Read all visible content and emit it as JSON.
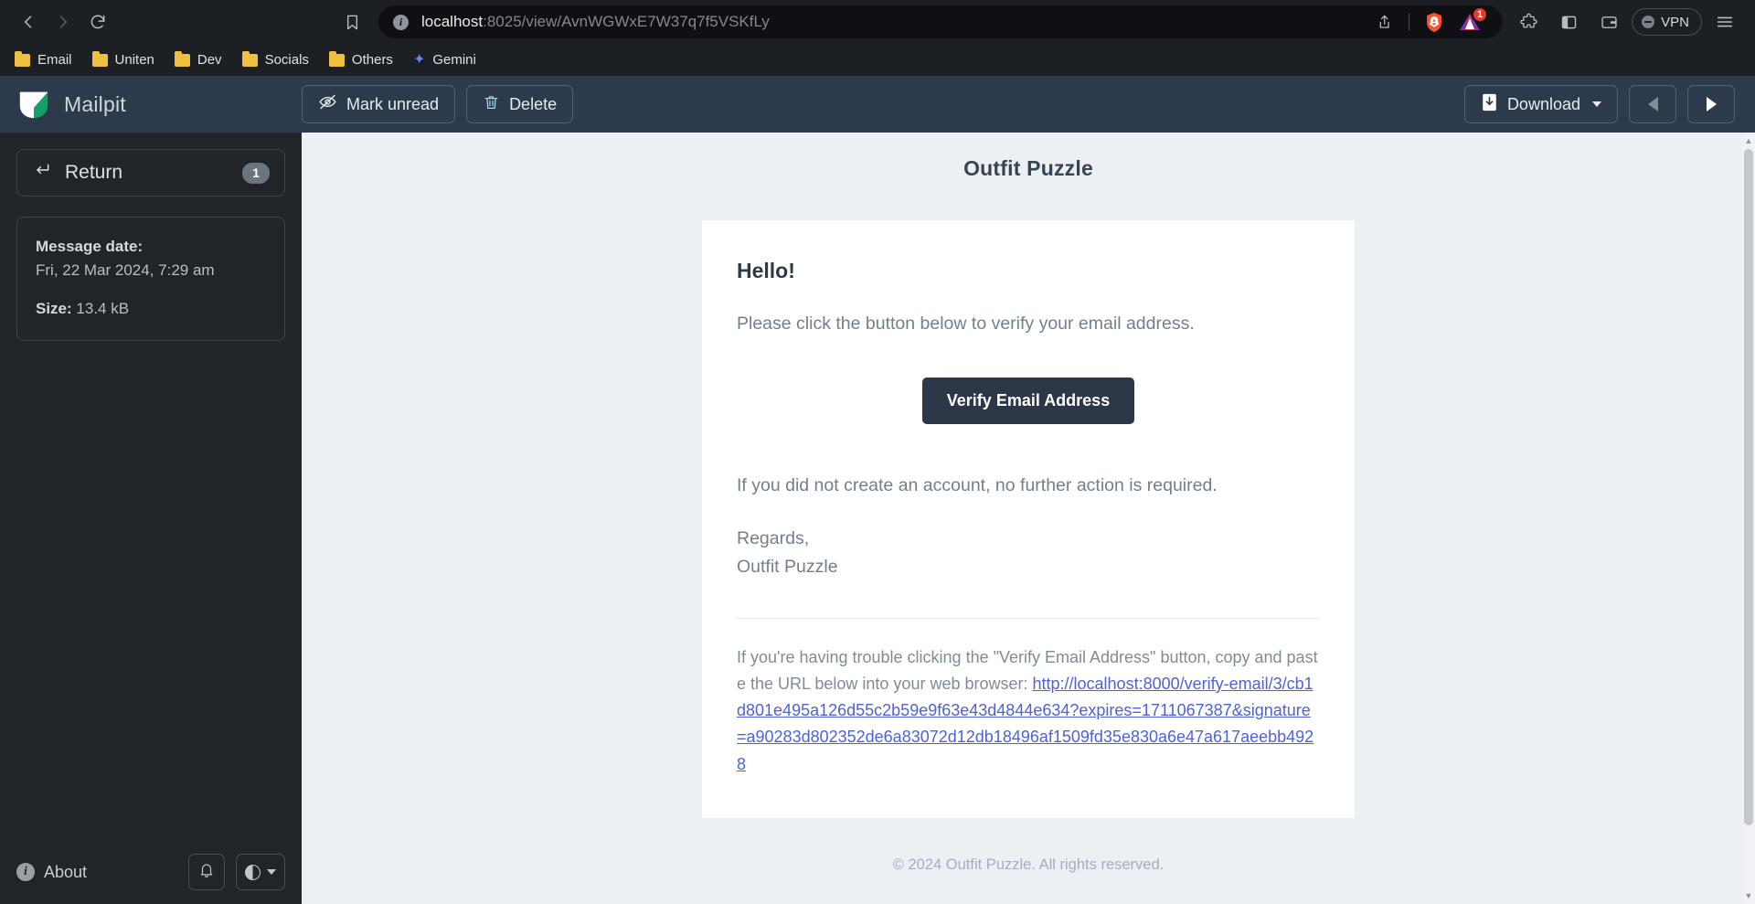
{
  "browser": {
    "url_host": "localhost",
    "url_rest": ":8025/view/AvnWGWxE7W37q7f5VSKfLy",
    "back_icon": "back-arrow-icon",
    "forward_icon": "forward-arrow-icon",
    "reload_icon": "reload-icon",
    "bookmark_icon": "bookmark-icon",
    "info_icon_char": "i",
    "share_icon": "share-icon",
    "shield_icon": "brave-shield-icon",
    "extension_badge": "1",
    "vpn_label": "VPN",
    "bookmarks": [
      {
        "label": "Email",
        "icon": "folder-icon"
      },
      {
        "label": "Uniten",
        "icon": "folder-icon"
      },
      {
        "label": "Dev",
        "icon": "folder-icon"
      },
      {
        "label": "Socials",
        "icon": "folder-icon"
      },
      {
        "label": "Others",
        "icon": "folder-icon"
      },
      {
        "label": "Gemini",
        "icon": "gemini-sparkle-icon"
      }
    ]
  },
  "app": {
    "brand": "Mailpit",
    "mark_unread_label": "Mark unread",
    "delete_label": "Delete",
    "download_label": "Download",
    "prev_icon": "previous-message-icon",
    "next_icon": "next-message-icon"
  },
  "sidebar": {
    "return_label": "Return",
    "return_badge": "1",
    "message_date_label": "Message date:",
    "message_date_value": "Fri, 22 Mar 2024, 7:29 am",
    "size_label": "Size:",
    "size_value": "13.4 kB",
    "about_label": "About",
    "bell_icon": "notification-bell-icon",
    "theme_icon": "theme-toggle-icon"
  },
  "email": {
    "title": "Outfit Puzzle",
    "greeting": "Hello!",
    "intro": "Please click the button below to verify your email address.",
    "cta_label": "Verify Email Address",
    "no_action": "If you did not create an account, no further action is required.",
    "regards": "Regards,",
    "signature": "Outfit Puzzle",
    "trouble_prefix": "If you're having trouble clicking the \"Verify Email Address\" button, copy and paste the URL below into your web browser: ",
    "trouble_link": "http://localhost:8000/verify-email/3/cb1d801e495a126d55c2b59e9f63e43d4844e634?expires=1711067387&signature=a90283d802352de6a83072d12db18496af1509fd35e830a6e47a617aeebb4928",
    "footer": "© 2024 Outfit Puzzle. All rights reserved."
  },
  "colors": {
    "header_bg": "#2c3a4b",
    "sidebar_bg": "#212529",
    "message_bg": "#eceff4",
    "cta_bg": "#2d3748",
    "link": "#4f62d8",
    "badge": "#6c757d",
    "brave_orange": "#fb542b",
    "ext_badge_red": "#e8342a"
  }
}
